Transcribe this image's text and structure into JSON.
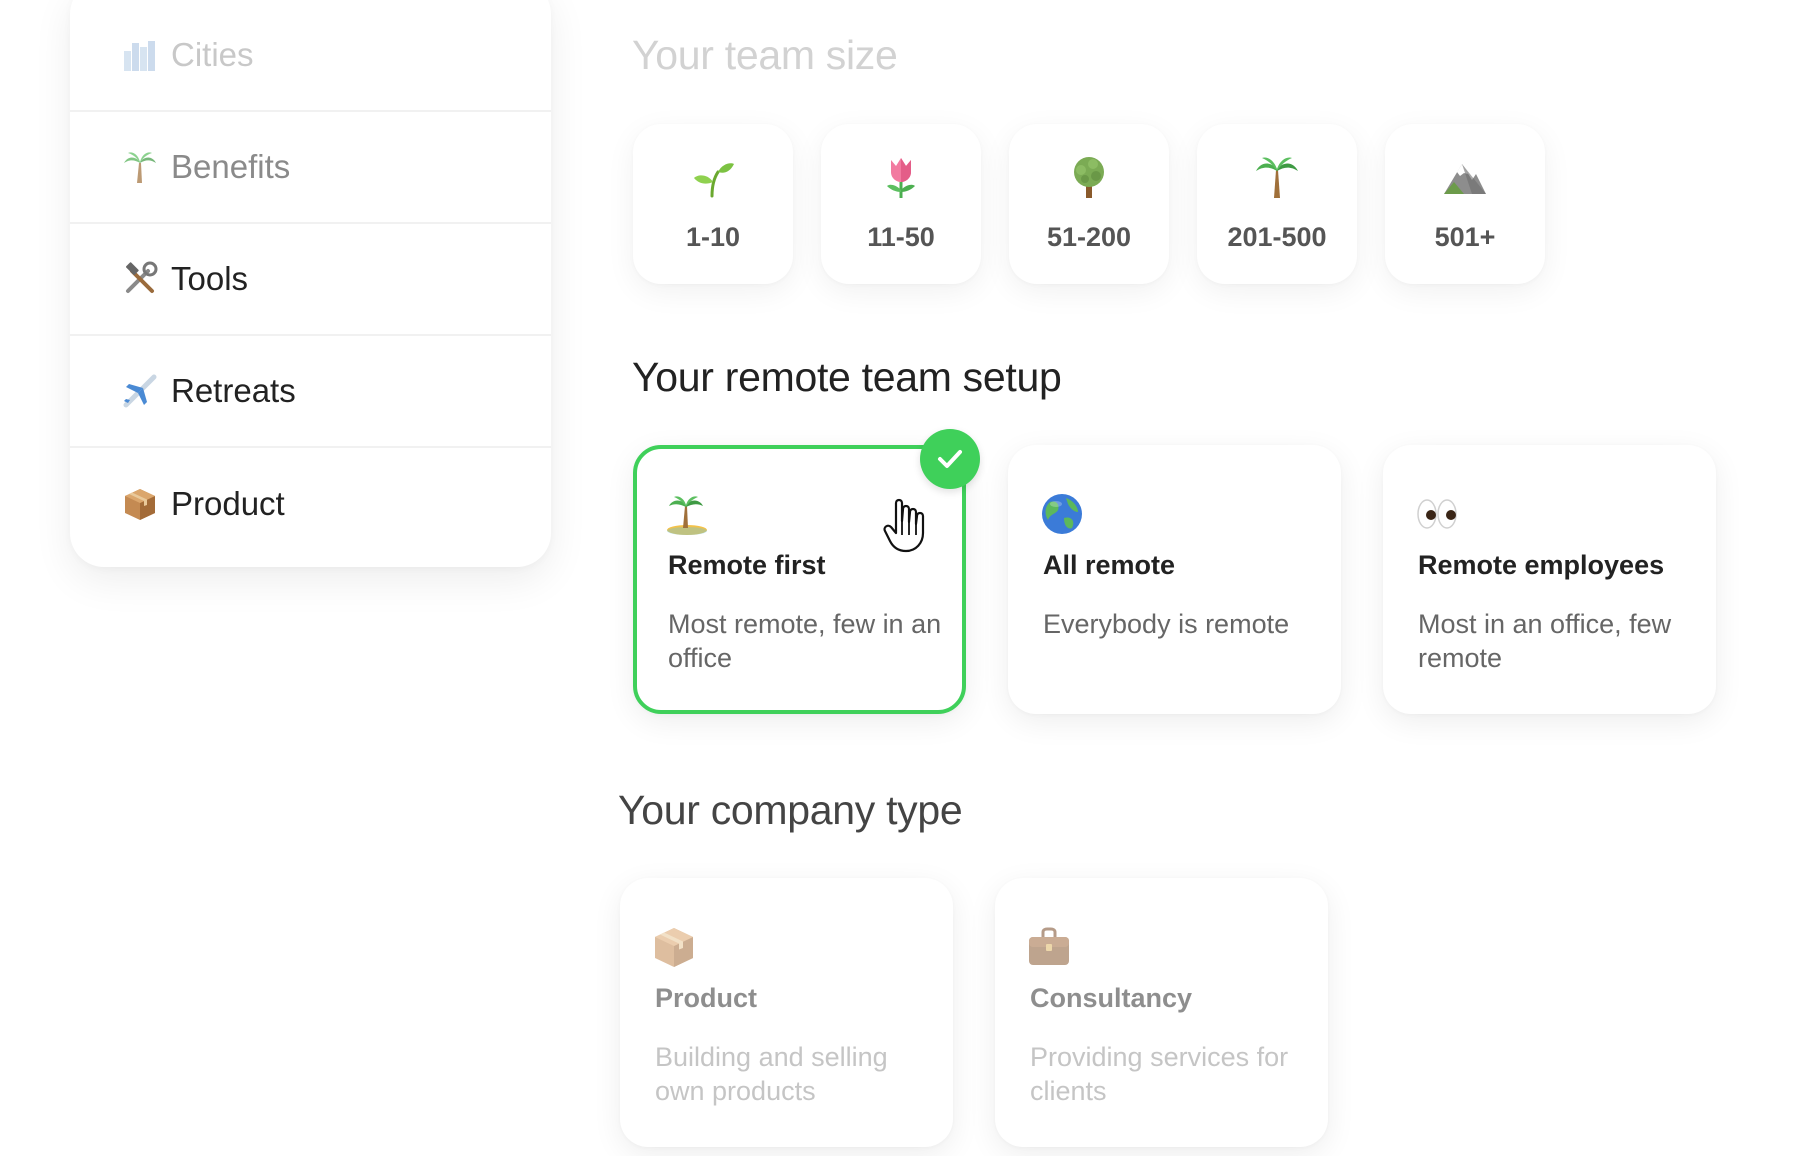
{
  "sidebar": {
    "items": [
      {
        "label": "Cities",
        "icon": "cityscape-icon"
      },
      {
        "label": "Benefits",
        "icon": "palm-tree-icon"
      },
      {
        "label": "Tools",
        "icon": "hammer-wrench-icon"
      },
      {
        "label": "Retreats",
        "icon": "airplane-icon"
      },
      {
        "label": "Product",
        "icon": "package-icon"
      }
    ]
  },
  "team_size": {
    "title": "Your team size",
    "options": [
      {
        "label": "1-10",
        "icon": "seedling-icon"
      },
      {
        "label": "11-50",
        "icon": "tulip-icon"
      },
      {
        "label": "51-200",
        "icon": "tree-icon"
      },
      {
        "label": "201-500",
        "icon": "palm-tree-icon"
      },
      {
        "label": "501+",
        "icon": "mountain-icon"
      }
    ]
  },
  "remote_setup": {
    "title": "Your remote team setup",
    "selected": "Remote first",
    "options": [
      {
        "title": "Remote first",
        "description": "Most remote, few in an office",
        "icon": "desert-island-icon"
      },
      {
        "title": "All remote",
        "description": "Everybody is remote",
        "icon": "globe-icon"
      },
      {
        "title": "Remote employees",
        "description": "Most in an office, few remote",
        "icon": "eyes-icon"
      }
    ]
  },
  "company_type": {
    "title": "Your company type",
    "options": [
      {
        "title": "Product",
        "description": "Building and selling own products",
        "icon": "package-icon"
      },
      {
        "title": "Consultancy",
        "description": "Providing services for clients",
        "icon": "briefcase-icon"
      }
    ]
  },
  "colors": {
    "accent_green": "#3fd05a",
    "text_dark": "#222222",
    "text_muted": "#666666"
  }
}
